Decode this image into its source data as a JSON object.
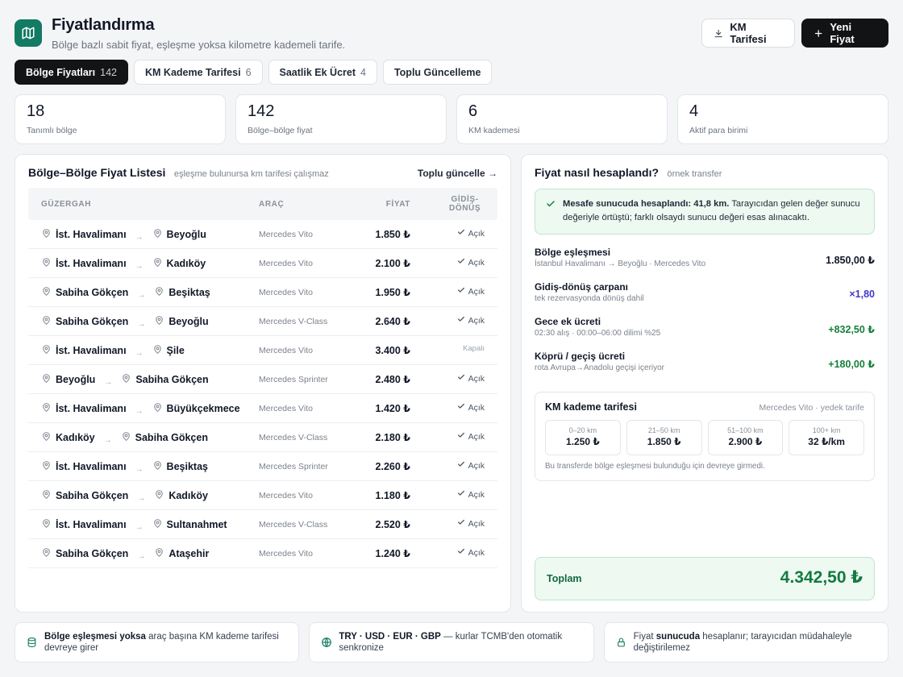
{
  "header": {
    "title": "Fiyatlandırma",
    "subtitle": "Bölge bazlı sabit fiyat, eşleşme yoksa kilometre kademeli tarife.",
    "km_button": "KM Tarifesi",
    "new_button": "Yeni Fiyat"
  },
  "tabs": [
    {
      "label": "Bölge Fiyatları",
      "count": "142",
      "active": true
    },
    {
      "label": "KM Kademe Tarifesi",
      "count": "6",
      "active": false
    },
    {
      "label": "Saatlik Ek Ücret",
      "count": "4",
      "active": false
    },
    {
      "label": "Toplu Güncelleme",
      "count": "",
      "active": false
    }
  ],
  "stats": [
    {
      "value": "18",
      "label": "Tanımlı bölge"
    },
    {
      "value": "142",
      "label": "Bölge–bölge fiyat"
    },
    {
      "value": "6",
      "label": "KM kademesi"
    },
    {
      "value": "4",
      "label": "Aktif para birimi"
    }
  ],
  "price_list": {
    "title": "Bölge–Bölge Fiyat Listesi",
    "hint": "eşleşme bulunursa km tarifesi çalışmaz",
    "link": "Toplu güncelle →",
    "columns": {
      "route": "GÜZERGAH",
      "car": "ARAÇ",
      "price": "FİYAT",
      "roundtrip_1": "GİDİŞ-",
      "roundtrip_2": "DÖNÜŞ"
    },
    "arrow": "→",
    "rows": [
      {
        "from": "İst. Havalimanı",
        "to": "Beyoğlu",
        "car": "Mercedes Vito",
        "price": "1.850 ₺",
        "rt": "Açık",
        "open": true
      },
      {
        "from": "İst. Havalimanı",
        "to": "Kadıköy",
        "car": "Mercedes Vito",
        "price": "2.100 ₺",
        "rt": "Açık",
        "open": true
      },
      {
        "from": "Sabiha Gökçen",
        "to": "Beşiktaş",
        "car": "Mercedes Vito",
        "price": "1.950 ₺",
        "rt": "Açık",
        "open": true
      },
      {
        "from": "Sabiha Gökçen",
        "to": "Beyoğlu",
        "car": "Mercedes V-Class",
        "price": "2.640 ₺",
        "rt": "Açık",
        "open": true
      },
      {
        "from": "İst. Havalimanı",
        "to": "Şile",
        "car": "Mercedes Vito",
        "price": "3.400 ₺",
        "rt": "Kapalı",
        "open": false
      },
      {
        "from": "Beyoğlu",
        "to": "Sabiha Gökçen",
        "car": "Mercedes Sprinter",
        "price": "2.480 ₺",
        "rt": "Açık",
        "open": true
      },
      {
        "from": "İst. Havalimanı",
        "to": "Büyükçekmece",
        "car": "Mercedes Vito",
        "price": "1.420 ₺",
        "rt": "Açık",
        "open": true
      },
      {
        "from": "Kadıköy",
        "to": "Sabiha Gökçen",
        "car": "Mercedes V-Class",
        "price": "2.180 ₺",
        "rt": "Açık",
        "open": true
      },
      {
        "from": "İst. Havalimanı",
        "to": "Beşiktaş",
        "car": "Mercedes Sprinter",
        "price": "2.260 ₺",
        "rt": "Açık",
        "open": true
      },
      {
        "from": "Sabiha Gökçen",
        "to": "Kadıköy",
        "car": "Mercedes Vito",
        "price": "1.180 ₺",
        "rt": "Açık",
        "open": true
      },
      {
        "from": "İst. Havalimanı",
        "to": "Sultanahmet",
        "car": "Mercedes V-Class",
        "price": "2.520 ₺",
        "rt": "Açık",
        "open": true
      },
      {
        "from": "Sabiha Gökçen",
        "to": "Ataşehir",
        "car": "Mercedes Vito",
        "price": "1.240 ₺",
        "rt": "Açık",
        "open": true
      }
    ]
  },
  "calc": {
    "title": "Fiyat nasıl hesaplandı?",
    "hint": "örnek transfer",
    "notice_bold": "Mesafe sunucuda hesaplandı: 41,8 km.",
    "notice_text": " Tarayıcıdan gelen değer sunucu değeriyle örtüştü; farklı olsaydı sunucu değeri esas alınacaktı.",
    "lines": [
      {
        "name": "Bölge eşleşmesi",
        "sub": "İstanbul Havalimanı → Beyoğlu · Mercedes Vito",
        "value": "1.850,00 ₺",
        "color": "#111827"
      },
      {
        "name": "Gidiş-dönüş çarpanı",
        "sub": "tek rezervasyonda dönüş dahil",
        "value": "×1,80",
        "color": "#4338ca"
      },
      {
        "name": "Gece ek ücreti",
        "sub": "02:30 alış · 00:00–06:00 dilimi %25",
        "value": "+832,50 ₺",
        "color": "#15803d"
      },
      {
        "name": "Köprü / geçiş ücreti",
        "sub": "rota Avrupa→Anadolu geçişi içeriyor",
        "value": "+180,00 ₺",
        "color": "#15803d"
      }
    ],
    "km": {
      "title": "KM kademe tarifesi",
      "meta": "Mercedes Vito · yedek tarife",
      "tiers": [
        {
          "range": "0–20 km",
          "price": "1.250 ₺"
        },
        {
          "range": "21–50 km",
          "price": "1.850 ₺"
        },
        {
          "range": "51–100 km",
          "price": "2.900 ₺"
        },
        {
          "range": "100+ km",
          "price": "32 ₺/km"
        }
      ],
      "note": "Bu transferde bölge eşleşmesi bulunduğu için devreye girmedi."
    },
    "total_label": "Toplam",
    "total_value": "4.342,50 ₺"
  },
  "footer": [
    {
      "icon": "database-icon",
      "bold": "Bölge eşleşmesi yoksa",
      "text": " araç başına KM kademe tarifesi devreye girer",
      "bold_first": true
    },
    {
      "icon": "globe-icon",
      "bold": "TRY · USD · EUR · GBP",
      "text": " — kurlar TCMB'den otomatik senkronize",
      "bold_first": true
    },
    {
      "icon": "lock-icon",
      "pre": "Fiyat ",
      "bold": "sunucuda",
      "text": " hesaplanır; tarayıcıdan müdahaleyle değiştirilemez",
      "bold_first": false
    }
  ],
  "colors": {
    "brand": "#137a63",
    "accent_green": "#15803d",
    "accent_purple": "#4338ca",
    "dark": "#111315"
  }
}
